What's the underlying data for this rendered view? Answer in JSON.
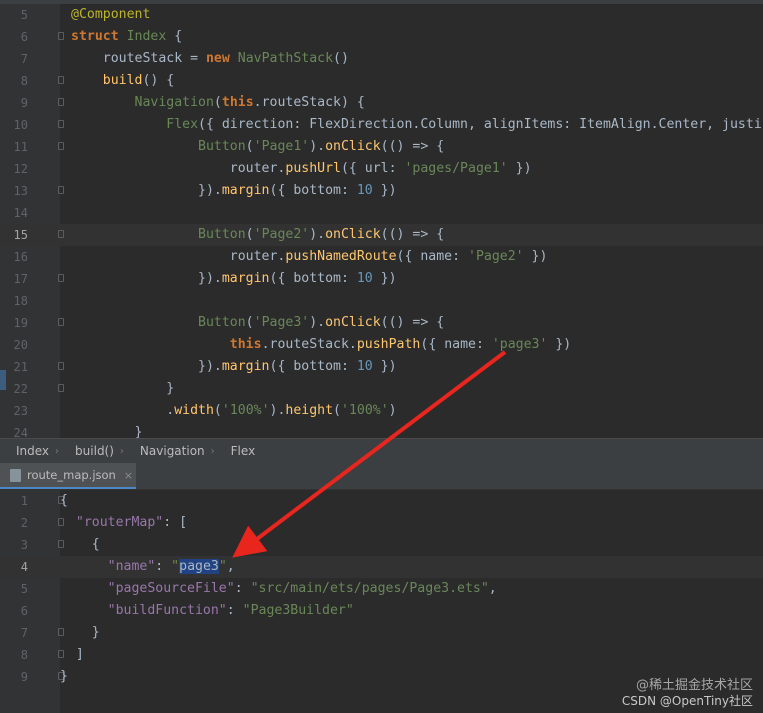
{
  "top_editor": {
    "lines": [
      {
        "n": "5",
        "parts": [
          [
            "ann",
            "@Component"
          ]
        ]
      },
      {
        "n": "6",
        "parts": [
          [
            "kw",
            "struct "
          ],
          [
            "ty",
            "Index"
          ],
          [
            "jp",
            " {"
          ]
        ]
      },
      {
        "n": "7",
        "parts": [
          [
            "jp",
            "    routeStack = "
          ],
          [
            "kw",
            "new "
          ],
          [
            "ty",
            "NavPathStack"
          ],
          [
            "jp",
            "()"
          ]
        ]
      },
      {
        "n": "8",
        "parts": [
          [
            "fn",
            "    build"
          ],
          [
            "jp",
            "() {"
          ]
        ]
      },
      {
        "n": "9",
        "parts": [
          [
            "ty",
            "        Navigation"
          ],
          [
            "jp",
            "("
          ],
          [
            "kw",
            "this"
          ],
          [
            "jp",
            ".routeStack) {"
          ]
        ]
      },
      {
        "n": "10",
        "parts": [
          [
            "ty",
            "            Flex"
          ],
          [
            "jp",
            "({ direction: FlexDirection.Column, alignItems: ItemAlign.Center, justify"
          ]
        ]
      },
      {
        "n": "11",
        "parts": [
          [
            "ty",
            "                Button"
          ],
          [
            "jp",
            "("
          ],
          [
            "str",
            "'Page1'"
          ],
          [
            "jp",
            ")."
          ],
          [
            "fn",
            "onClick"
          ],
          [
            "jp",
            "(() => {"
          ]
        ]
      },
      {
        "n": "12",
        "parts": [
          [
            "jp",
            "                    router."
          ],
          [
            "fn",
            "pushUrl"
          ],
          [
            "jp",
            "({ url: "
          ],
          [
            "str",
            "'pages/Page1'"
          ],
          [
            "jp",
            " })"
          ]
        ]
      },
      {
        "n": "13",
        "parts": [
          [
            "jp",
            "                })."
          ],
          [
            "fn",
            "margin"
          ],
          [
            "jp",
            "({ bottom: "
          ],
          [
            "num",
            "10"
          ],
          [
            "jp",
            " })"
          ]
        ]
      },
      {
        "n": "14",
        "parts": [
          [
            "jp",
            ""
          ]
        ]
      },
      {
        "n": "15",
        "parts": [
          [
            "ty",
            "                Button"
          ],
          [
            "jp",
            "("
          ],
          [
            "str",
            "'Page2'"
          ],
          [
            "jp",
            ")."
          ],
          [
            "fn",
            "onClick"
          ],
          [
            "jp",
            "(() => {"
          ]
        ]
      },
      {
        "n": "16",
        "parts": [
          [
            "jp",
            "                    router."
          ],
          [
            "fn",
            "pushNamedRoute"
          ],
          [
            "jp",
            "({ name: "
          ],
          [
            "str",
            "'Page2'"
          ],
          [
            "jp",
            " })"
          ]
        ]
      },
      {
        "n": "17",
        "parts": [
          [
            "jp",
            "                })."
          ],
          [
            "fn",
            "margin"
          ],
          [
            "jp",
            "({ bottom: "
          ],
          [
            "num",
            "10"
          ],
          [
            "jp",
            " })"
          ]
        ]
      },
      {
        "n": "18",
        "parts": [
          [
            "jp",
            ""
          ]
        ]
      },
      {
        "n": "19",
        "parts": [
          [
            "ty",
            "                Button"
          ],
          [
            "jp",
            "("
          ],
          [
            "str",
            "'Page3'"
          ],
          [
            "jp",
            ")."
          ],
          [
            "fn",
            "onClick"
          ],
          [
            "jp",
            "(() => {"
          ]
        ]
      },
      {
        "n": "20",
        "parts": [
          [
            "kw",
            "                    this"
          ],
          [
            "jp",
            ".routeStack."
          ],
          [
            "fn",
            "pushPath"
          ],
          [
            "jp",
            "({ name: "
          ],
          [
            "str",
            "'page3'"
          ],
          [
            "jp",
            " })"
          ]
        ]
      },
      {
        "n": "21",
        "parts": [
          [
            "jp",
            "                })."
          ],
          [
            "fn",
            "margin"
          ],
          [
            "jp",
            "({ bottom: "
          ],
          [
            "num",
            "10"
          ],
          [
            "jp",
            " })"
          ]
        ]
      },
      {
        "n": "22",
        "parts": [
          [
            "jp",
            "            }"
          ]
        ]
      },
      {
        "n": "23",
        "parts": [
          [
            "jp",
            "            ."
          ],
          [
            "fn",
            "width"
          ],
          [
            "jp",
            "("
          ],
          [
            "str",
            "'100%'"
          ],
          [
            "jp",
            ")."
          ],
          [
            "fn",
            "height"
          ],
          [
            "jp",
            "("
          ],
          [
            "str",
            "'100%'"
          ],
          [
            "jp",
            ")"
          ]
        ]
      },
      {
        "n": "24",
        "parts": [
          [
            "jp",
            "        }"
          ]
        ]
      }
    ],
    "current_line": "15"
  },
  "breadcrumb": [
    "Index",
    "build()",
    "Navigation",
    "Flex"
  ],
  "tab": {
    "filename": "route_map.json",
    "close": "×"
  },
  "bottom_editor": {
    "lines": [
      {
        "n": "1",
        "parts": [
          [
            "jp",
            "{"
          ]
        ]
      },
      {
        "n": "2",
        "parts": [
          [
            "jp",
            "  "
          ],
          [
            "jkey",
            "\"routerMap\""
          ],
          [
            "jp",
            ": ["
          ]
        ]
      },
      {
        "n": "3",
        "parts": [
          [
            "jp",
            "    {"
          ]
        ]
      },
      {
        "n": "4",
        "parts": [
          [
            "jp",
            "      "
          ],
          [
            "jkey",
            "\"name\""
          ],
          [
            "jp",
            ": "
          ],
          [
            "jstr",
            "\""
          ],
          [
            "sel",
            "page3"
          ],
          [
            "jstr",
            "\""
          ],
          [
            "jp",
            ","
          ]
        ]
      },
      {
        "n": "5",
        "parts": [
          [
            "jp",
            "      "
          ],
          [
            "jkey",
            "\"pageSourceFile\""
          ],
          [
            "jp",
            ": "
          ],
          [
            "jstr",
            "\"src/main/ets/pages/Page3.ets\""
          ],
          [
            "jp",
            ","
          ]
        ]
      },
      {
        "n": "6",
        "parts": [
          [
            "jp",
            "      "
          ],
          [
            "jkey",
            "\"buildFunction\""
          ],
          [
            "jp",
            ": "
          ],
          [
            "jstr",
            "\"Page3Builder\""
          ]
        ]
      },
      {
        "n": "7",
        "parts": [
          [
            "jp",
            "    }"
          ]
        ]
      },
      {
        "n": "8",
        "parts": [
          [
            "jp",
            "  ]"
          ]
        ]
      },
      {
        "n": "9",
        "parts": [
          [
            "jp",
            "}"
          ]
        ]
      }
    ],
    "current_line": "4"
  },
  "watermark": {
    "line1": "@稀土掘金技术社区",
    "line2": "CSDN @OpenTiny社区"
  },
  "colors": {
    "arrow": "#e8261e",
    "selection": "#214283",
    "tab_underline": "#4a88c7"
  }
}
